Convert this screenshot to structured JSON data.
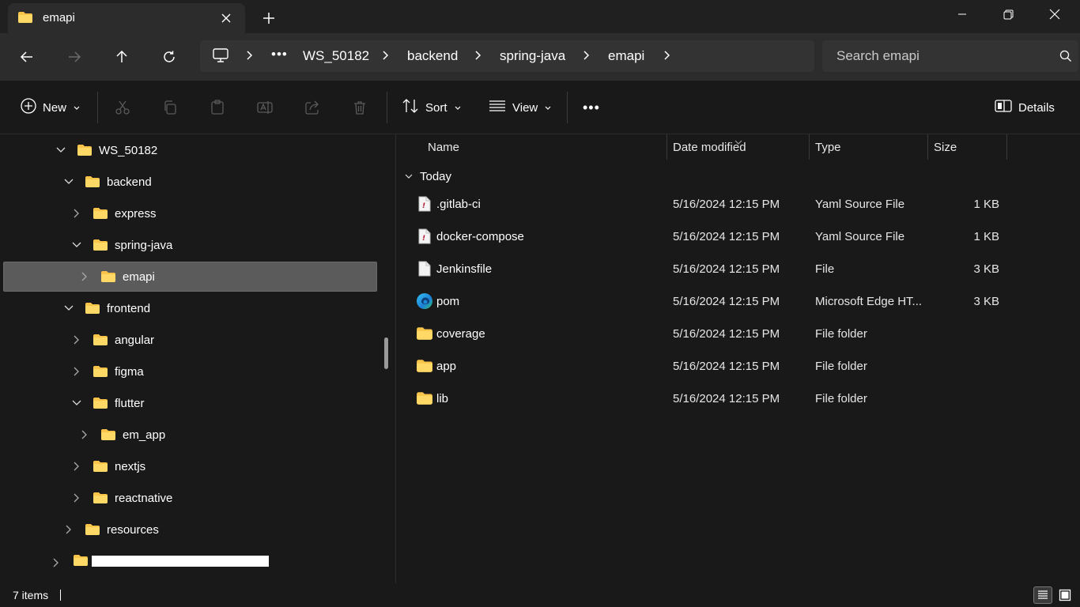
{
  "window": {
    "tab_title": "emapi"
  },
  "address": {
    "crumbs": [
      "WS_50182",
      "backend",
      "spring-java",
      "emapi"
    ],
    "overflow": "•••"
  },
  "search": {
    "placeholder": "Search emapi"
  },
  "commands": {
    "new_label": "New",
    "sort_label": "Sort",
    "view_label": "View",
    "more_label": "•••",
    "details_label": "Details"
  },
  "tree": [
    {
      "label": "WS_50182",
      "expanded": true
    },
    {
      "label": "backend",
      "expanded": true
    },
    {
      "label": "express",
      "expanded": false
    },
    {
      "label": "spring-java",
      "expanded": true
    },
    {
      "label": "emapi",
      "expanded": false,
      "selected": true
    },
    {
      "label": "frontend",
      "expanded": true
    },
    {
      "label": "angular",
      "expanded": false
    },
    {
      "label": "figma",
      "expanded": false
    },
    {
      "label": "flutter",
      "expanded": true
    },
    {
      "label": "em_app",
      "expanded": false
    },
    {
      "label": "nextjs",
      "expanded": false
    },
    {
      "label": "reactnative",
      "expanded": false
    },
    {
      "label": "resources",
      "expanded": false
    }
  ],
  "columns": {
    "name": "Name",
    "date": "Date modified",
    "type": "Type",
    "size": "Size"
  },
  "group": {
    "label": "Today"
  },
  "files": [
    {
      "name": ".gitlab-ci",
      "date": "5/16/2024 12:15 PM",
      "type": "Yaml Source File",
      "size": "1 KB",
      "icon": "yaml-file-icon"
    },
    {
      "name": "docker-compose",
      "date": "5/16/2024 12:15 PM",
      "type": "Yaml Source File",
      "size": "1 KB",
      "icon": "yaml-file-icon"
    },
    {
      "name": "Jenkinsfile",
      "date": "5/16/2024 12:15 PM",
      "type": "File",
      "size": "3 KB",
      "icon": "file-icon"
    },
    {
      "name": "pom",
      "date": "5/16/2024 12:15 PM",
      "type": "Microsoft Edge HT...",
      "size": "3 KB",
      "icon": "edge-icon"
    },
    {
      "name": "coverage",
      "date": "5/16/2024 12:15 PM",
      "type": "File folder",
      "size": "",
      "icon": "folder-icon"
    },
    {
      "name": "app",
      "date": "5/16/2024 12:15 PM",
      "type": "File folder",
      "size": "",
      "icon": "folder-icon"
    },
    {
      "name": "lib",
      "date": "5/16/2024 12:15 PM",
      "type": "File folder",
      "size": "",
      "icon": "folder-icon"
    }
  ],
  "status": {
    "item_count": "7 items"
  },
  "colors": {
    "folder": "#f8c54a",
    "background": "#191919",
    "selection": "#5b5b5b"
  }
}
